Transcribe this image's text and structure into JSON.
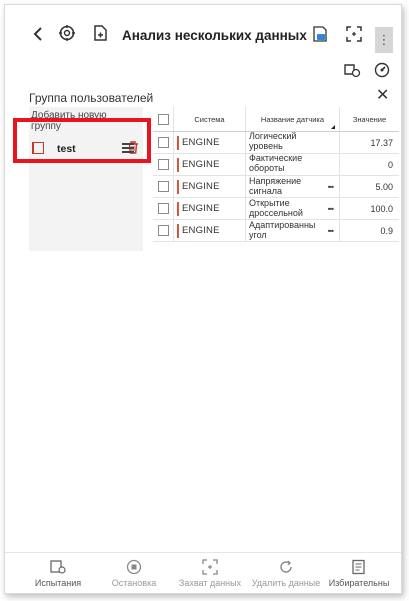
{
  "header": {
    "title": "Анализ нескольких данных",
    "back_icon": "chevron-left-icon",
    "icons": [
      "brain-gear-icon",
      "add-file-icon",
      "pdf-export-icon",
      "screenshot-frame-icon",
      "more-vertical-icon"
    ],
    "more_label": "⋮"
  },
  "toolbar": {
    "icons": [
      "car-settings-icon",
      "gauge-icon"
    ]
  },
  "group_panel": {
    "title": "Группа пользователей",
    "add_group_label": "Добавить новую группу",
    "items": [
      {
        "name": "test"
      }
    ]
  },
  "table": {
    "headers": {
      "system": "Система",
      "sensor_name": "Название датчика",
      "value": "Значение"
    },
    "rows": [
      {
        "system": "ENGINE",
        "name": "Логический уровень напряжения",
        "value": "17.37",
        "has_more": false
      },
      {
        "system": "ENGINE",
        "name": "Фактические обороты двигателя",
        "value": "0",
        "has_more": false
      },
      {
        "system": "ENGINE",
        "name": "Напряжение сигнала",
        "value": "5.00",
        "has_more": true
      },
      {
        "system": "ENGINE",
        "name": "Открытие дроссельной",
        "value": "100.0",
        "has_more": true
      },
      {
        "system": "ENGINE",
        "name": "Адаптированный угол",
        "value": "0.9",
        "has_more": true
      }
    ],
    "more_label": "•••"
  },
  "bottom_nav": {
    "items": [
      {
        "label": "Испытания",
        "icon": "car-test-icon"
      },
      {
        "label": "Остановка",
        "icon": "stop-circle-icon"
      },
      {
        "label": "Захват данных",
        "icon": "capture-frame-icon"
      },
      {
        "label": "Удалить данные",
        "icon": "refresh-icon"
      },
      {
        "label": "Избирательны",
        "icon": "selective-list-icon"
      }
    ]
  },
  "colors": {
    "accent_red": "#e8141e",
    "system_bar": "#d4583b",
    "trash": "#c0392b"
  }
}
